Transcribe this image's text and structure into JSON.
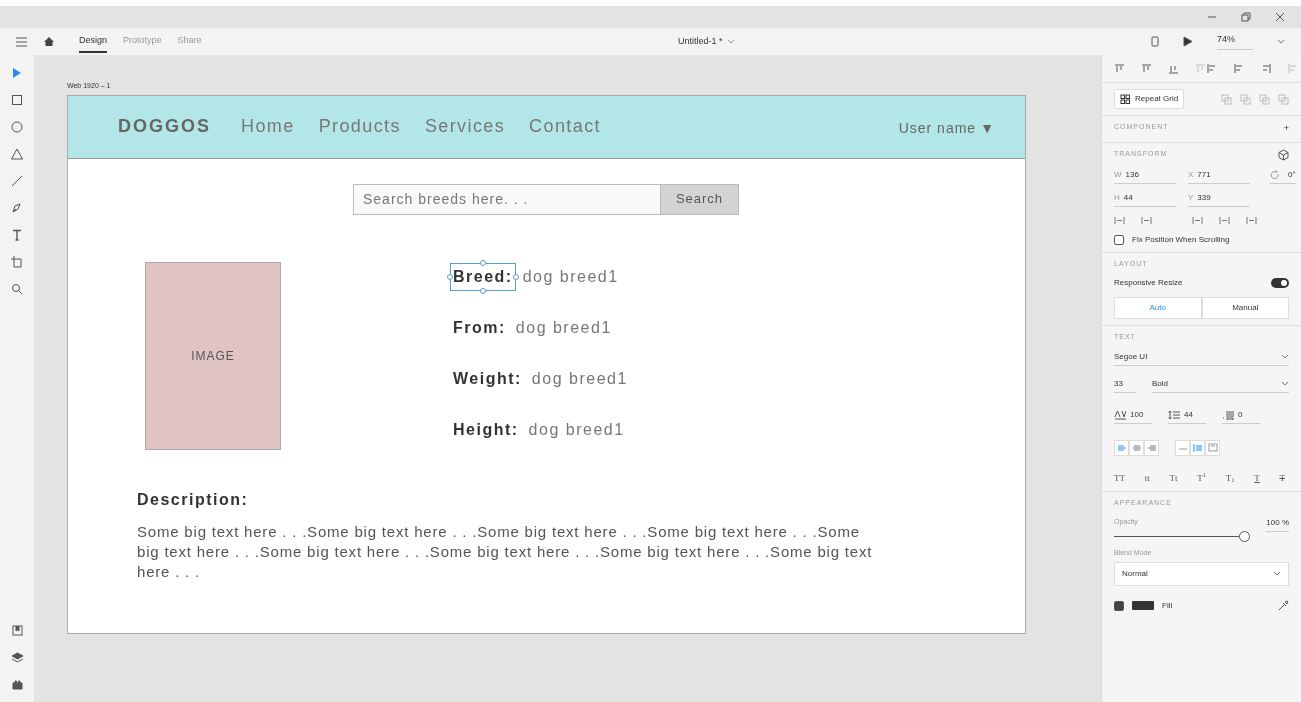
{
  "app_bar": {
    "tabs": [
      {
        "label": "Design",
        "selected": true
      },
      {
        "label": "Prototype",
        "selected": false
      },
      {
        "label": "Share",
        "selected": false
      }
    ],
    "document_title": "Untitled-1 *",
    "zoom": "74%"
  },
  "tools": [
    {
      "kind": "select",
      "selected": true
    },
    {
      "kind": "rectangle",
      "selected": false
    },
    {
      "kind": "ellipse",
      "selected": false
    },
    {
      "kind": "polygon",
      "selected": false
    },
    {
      "kind": "line",
      "selected": false
    },
    {
      "kind": "pen",
      "selected": false
    },
    {
      "kind": "text",
      "selected": false
    },
    {
      "kind": "artboard",
      "selected": false
    },
    {
      "kind": "zoom",
      "selected": false
    }
  ],
  "artboard": {
    "label": "Web 1920 – 1",
    "navbar": {
      "brand": "DOGGOS",
      "links": [
        "Home",
        "Products",
        "Services",
        "Contact"
      ],
      "user": "User name",
      "caret": "▼"
    },
    "search": {
      "placeholder": "Search breeds here. . .",
      "button": "Search"
    },
    "image": {
      "label": "IMAGE"
    },
    "details": [
      {
        "label": "Breed:",
        "value": "dog breed1",
        "selected": true
      },
      {
        "label": "From:",
        "value": "dog breed1",
        "selected": false
      },
      {
        "label": "Weight:",
        "value": "dog breed1",
        "selected": false
      },
      {
        "label": "Height:",
        "value": "dog breed1",
        "selected": false
      }
    ],
    "description": {
      "heading": "Description:",
      "text": "Some big text here . . .Some big text here . . .Some big text here . . .Some big text here . . .Some big text here . . .Some big text here . . .Some big text here . . .Some big text here . . .Some big text here . . ."
    }
  },
  "panel": {
    "repeat_grid": "Repeat Grid",
    "component": "COMPONENT",
    "component_add": "+",
    "transform": {
      "heading": "TRANSFORM",
      "fields": [
        {
          "label": "W",
          "value": "136"
        },
        {
          "label": "X",
          "value": "771"
        },
        {
          "label": "H",
          "value": "44"
        },
        {
          "label": "Y",
          "value": "339"
        }
      ],
      "rotation": "0°",
      "fix_position": {
        "label": "Fix Position When Scrolling",
        "checked": false
      }
    },
    "layout": {
      "heading": "LAYOUT",
      "responsive_resize": {
        "label": "Responsive Resize",
        "on": true
      },
      "modes": [
        {
          "label": "Auto",
          "selected": true
        },
        {
          "label": "Manual",
          "selected": false
        }
      ]
    },
    "text": {
      "heading": "TEXT",
      "font": "Segoe UI",
      "size": "33",
      "weight": "Bold",
      "char_spacing": "100",
      "line_spacing": "44",
      "paragraph_spacing": "0",
      "align": [
        {
          "kind": "left",
          "selected": true
        },
        {
          "kind": "center",
          "selected": false
        },
        {
          "kind": "right",
          "selected": false
        }
      ],
      "sizing": [
        {
          "kind": "auto-width",
          "selected": false
        },
        {
          "kind": "auto-height",
          "selected": true
        },
        {
          "kind": "fixed",
          "selected": false
        }
      ],
      "styles": [
        {
          "label": "TT",
          "kind": "plain"
        },
        {
          "label": "tt",
          "kind": "plain"
        },
        {
          "label": "Tt",
          "kind": "plain"
        },
        {
          "label": "T$^{1}$",
          "kind": "plain"
        },
        {
          "label": "T$_{1}$",
          "kind": "plain"
        },
        {
          "label": "T",
          "kind": "underline"
        },
        {
          "label": "T",
          "kind": "strike"
        }
      ]
    },
    "appearance": {
      "heading": "APPEARANCE",
      "opacity_label": "Opacity",
      "opacity": {
        "level": 1.0
      },
      "opacity_reading": "100 %",
      "blend_label": "Blend Mode",
      "blend": "Normal",
      "fill": {
        "label": "Fill",
        "checked": true
      }
    }
  }
}
